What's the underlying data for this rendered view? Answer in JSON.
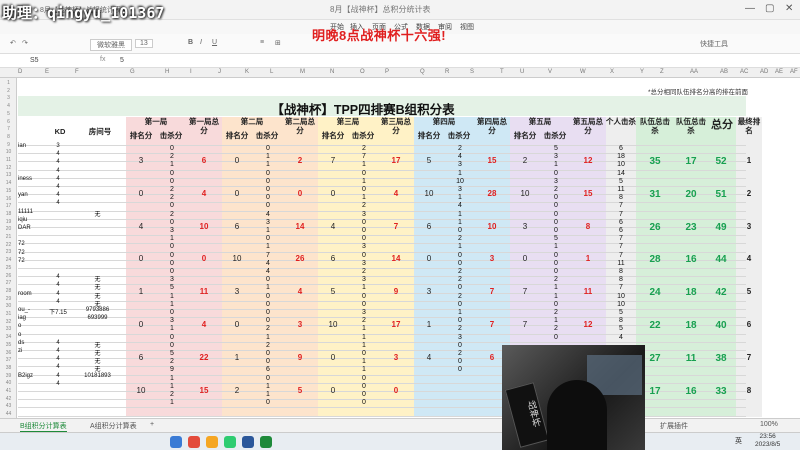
{
  "watermark": "助理：qingyu_101367",
  "window": {
    "title": "8月【战神杯】总积分统计表",
    "tabs": [
      "8月【战神杯】战报统计表"
    ]
  },
  "ribbon_tabs": [
    "开始",
    "插入",
    "页面",
    "公式",
    "数据",
    "审阅",
    "视图"
  ],
  "toolbar": {
    "font": "微软雅黑",
    "size": "13",
    "buttons": [
      "B",
      "I",
      "U"
    ],
    "right": "快捷工具"
  },
  "banner": "明晚8点战神杯十六强!",
  "formula_bar": {
    "cell_ref": "S5",
    "value": "5"
  },
  "column_letters": [
    "D",
    "E",
    "F",
    "G",
    "H",
    "I",
    "J",
    "K",
    "L",
    "M",
    "N",
    "O",
    "P",
    "Q",
    "R",
    "S",
    "T",
    "U",
    "V",
    "W",
    "X",
    "Y",
    "Z",
    "AA",
    "AB",
    "AC",
    "AD",
    "AE",
    "AF"
  ],
  "note": "*总分相同队伍排名分高的排在前面",
  "main_title": "【战神杯】TPP四排赛B组积分表",
  "headers": {
    "kd": "KD",
    "room": "房间号",
    "rounds": [
      "第一局",
      "第二局",
      "第三局",
      "第四局",
      "第五局"
    ],
    "rank_pts": "排名分",
    "kill_pts": "击杀分",
    "round_totals": [
      "第一局总分",
      "第二局总分",
      "第三局总分",
      "第四局总分",
      "第五局总分"
    ],
    "personal": "个人击杀",
    "team_kills": "队伍总击杀",
    "team_kill_pts": "队伍总击杀",
    "total": "总分",
    "final_rank": "最终排名"
  },
  "players": [
    {
      "name": "ian",
      "kd": "3"
    },
    {
      "name": "",
      "kd": "4"
    },
    {
      "name": "",
      "kd": "4"
    },
    {
      "name": "",
      "kd": "4"
    },
    {
      "name": "iness",
      "kd": "4"
    },
    {
      "name": "",
      "kd": "4"
    },
    {
      "name": "yan",
      "kd": "4"
    },
    {
      "name": "",
      "kd": "4"
    },
    {
      "name": "11111",
      "kd": "",
      "room": "无"
    },
    {
      "name": "iqiu",
      "kd": ""
    },
    {
      "name": "DAR",
      "kd": ""
    },
    {
      "name": "",
      "kd": ""
    },
    {
      "name": "72",
      "kd": ""
    },
    {
      "name": "72",
      "kd": ""
    },
    {
      "name": "72",
      "kd": ""
    },
    {
      "name": "",
      "kd": ""
    },
    {
      "name": "",
      "kd": "4",
      "room": "无"
    },
    {
      "name": "",
      "kd": "4",
      "room": "无"
    },
    {
      "name": "room",
      "kd": "4",
      "room": "无"
    },
    {
      "name": "",
      "kd": "4",
      "room": "无"
    },
    {
      "name": "ou_-",
      "kd": "下7.15",
      "room": "9793886"
    },
    {
      "name": "iag",
      "kd": "",
      "room": "693999"
    },
    {
      "name": "o",
      "kd": ""
    },
    {
      "name": "o",
      "kd": ""
    },
    {
      "name": "ds",
      "kd": "4",
      "room": "无"
    },
    {
      "name": "zi",
      "kd": "4",
      "room": "无"
    },
    {
      "name": "",
      "kd": "4",
      "room": "无"
    },
    {
      "name": "",
      "kd": "4",
      "room": "无"
    },
    {
      "name": "B2igz",
      "kd": "4",
      "room": "10181893"
    },
    {
      "name": "",
      "kd": "4"
    },
    {
      "name": "",
      "kd": ""
    },
    {
      "name": "",
      "kd": ""
    }
  ],
  "teams": [
    {
      "r1": [
        "3",
        "6"
      ],
      "r2": [
        "0",
        "2"
      ],
      "r3": [
        "7",
        "17"
      ],
      "r4": [
        "5",
        "15"
      ],
      "r5": [
        "2",
        "12"
      ],
      "kills": [
        [
          "0",
          "2",
          "1",
          "0"
        ],
        [
          "0",
          "1",
          "1",
          "0"
        ],
        [
          "2",
          "7",
          "1",
          "0"
        ],
        [
          "2",
          "4",
          "3",
          "1"
        ],
        [
          "5",
          "3",
          "1",
          "0"
        ]
      ],
      "personal": [
        "6",
        "18",
        "10",
        "14"
      ],
      "team_kills": "35",
      "team_kill_pts": "17",
      "total": "52",
      "final": "1"
    },
    {
      "r1": [
        "0",
        "4"
      ],
      "r2": [
        "0",
        "0"
      ],
      "r3": [
        "0",
        "4"
      ],
      "r4": [
        "10",
        "28"
      ],
      "r5": [
        "10",
        "15"
      ],
      "kills": [
        [
          "0",
          "2",
          "2",
          "0"
        ],
        [
          "0",
          "0",
          "0",
          "0"
        ],
        [
          "1",
          "0",
          "1",
          "2"
        ],
        [
          "10",
          "3",
          "1",
          "4"
        ],
        [
          "3",
          "2",
          "0",
          "0"
        ]
      ],
      "personal": [
        "5",
        "11",
        "8",
        "7"
      ],
      "team_kills": "31",
      "team_kill_pts": "20",
      "total": "51",
      "final": "2"
    },
    {
      "r1": [
        "4",
        "10"
      ],
      "r2": [
        "6",
        "14"
      ],
      "r3": [
        "4",
        "7"
      ],
      "r4": [
        "6",
        "10"
      ],
      "r5": [
        "3",
        "8"
      ],
      "kills": [
        [
          "2",
          "0",
          "3",
          "1"
        ],
        [
          "4",
          "3",
          "1",
          "0"
        ],
        [
          "3",
          "0",
          "0",
          "0"
        ],
        [
          "1",
          "1",
          "0",
          "2"
        ],
        [
          "0",
          "0",
          "0",
          "5"
        ]
      ],
      "personal": [
        "7",
        "6",
        "6",
        "7"
      ],
      "team_kills": "26",
      "team_kill_pts": "23",
      "total": "49",
      "third": "3",
      "final": "3"
    },
    {
      "r1": [
        "0",
        "0"
      ],
      "r2": [
        "10",
        "26"
      ],
      "r3": [
        "6",
        "14"
      ],
      "r4": [
        "0",
        "3"
      ],
      "r5": [
        "0",
        "1"
      ],
      "kills": [
        [
          "0",
          "0",
          "0",
          "0"
        ],
        [
          "1",
          "7",
          "4",
          "4"
        ],
        [
          "3",
          "0",
          "3",
          "2"
        ],
        [
          "1",
          "0",
          "0",
          "2"
        ],
        [
          "1",
          "0",
          "0",
          "0"
        ]
      ],
      "personal": [
        "7",
        "7",
        "11",
        "8"
      ],
      "team_kills": "28",
      "team_kill_pts": "16",
      "total": "44",
      "final": "4"
    },
    {
      "r1": [
        "1",
        "11"
      ],
      "r2": [
        "3",
        "4"
      ],
      "r3": [
        "5",
        "9"
      ],
      "r4": [
        "3",
        "7"
      ],
      "r5": [
        "7",
        "11"
      ],
      "kills": [
        [
          "3",
          "5",
          "1",
          "1"
        ],
        [
          "0",
          "1",
          "0",
          "0"
        ],
        [
          "3",
          "1",
          "0",
          "0"
        ],
        [
          "2",
          "0",
          "2",
          "0"
        ],
        [
          "2",
          "1",
          "1",
          "0"
        ]
      ],
      "personal": [
        "8",
        "7",
        "10",
        "10"
      ],
      "team_kills": "24",
      "team_kill_pts": "18",
      "total": "42",
      "final": "5"
    },
    {
      "r1": [
        "0",
        "4"
      ],
      "r2": [
        "0",
        "3"
      ],
      "r3": [
        "10",
        "17"
      ],
      "r4": [
        "1",
        "7"
      ],
      "r5": [
        "7",
        "12"
      ],
      "kills": [
        [
          "0",
          "3",
          "1",
          "0"
        ],
        [
          "0",
          "0",
          "2",
          "1"
        ],
        [
          "3",
          "2",
          "1",
          "1"
        ],
        [
          "1",
          "0",
          "2",
          "3"
        ],
        [
          "2",
          "1",
          "2",
          "0"
        ]
      ],
      "personal": [
        "5",
        "8",
        "5",
        "4"
      ],
      "team_kills": "22",
      "team_kill_pts": "18",
      "total": "40",
      "final": "6"
    },
    {
      "r1": [
        "6",
        "22"
      ],
      "r2": [
        "1",
        "9"
      ],
      "r3": [
        "0",
        "3"
      ],
      "r4": [
        "4",
        "6"
      ],
      "r5": [
        "",
        ""
      ],
      "kills": [
        [
          "0",
          "5",
          "2",
          "9"
        ],
        [
          "2",
          "0",
          "0",
          "6"
        ],
        [
          "1",
          "0",
          "1",
          "1"
        ],
        [
          "0",
          "2",
          "0",
          "0"
        ],
        [
          "",
          "",
          "",
          ""
        ]
      ],
      "personal": [
        "",
        "",
        "",
        ""
      ],
      "team_kills": "27",
      "team_kill_pts": "11",
      "total": "38",
      "final": "7"
    },
    {
      "r1": [
        "10",
        "15"
      ],
      "r2": [
        "2",
        "5"
      ],
      "r3": [
        "0",
        "0"
      ],
      "r4": [
        "",
        ""
      ],
      "r5": [
        "",
        ""
      ],
      "kills": [
        [
          "1",
          "1",
          "2",
          "1"
        ],
        [
          "0",
          "1",
          "1",
          "0"
        ],
        [
          "0",
          "0",
          "0",
          "0"
        ],
        [
          "",
          "",
          "",
          ""
        ],
        [
          "",
          "",
          "",
          ""
        ]
      ],
      "personal": [
        "",
        "",
        "",
        ""
      ],
      "team_kills": "17",
      "team_kill_pts": "16",
      "total": "33",
      "final": "8"
    }
  ],
  "sheet_tabs": [
    "B组积分计算表",
    "A组积分计算表"
  ],
  "status": {
    "right": "扩展插件",
    "zoom": "100%"
  },
  "taskbar": {
    "time": "23:56",
    "date": "2023/8/5",
    "lang": "英"
  },
  "webcam_text": "战神杯",
  "colors": {
    "r1": "#f8dadb",
    "r2": "#fde4cc",
    "r3": "#fff2c6",
    "r4": "#cfe8f5",
    "r5": "#e8def2",
    "total": "#d6efd9",
    "grey": "#eeeeee",
    "banner": "#e01f1f"
  }
}
